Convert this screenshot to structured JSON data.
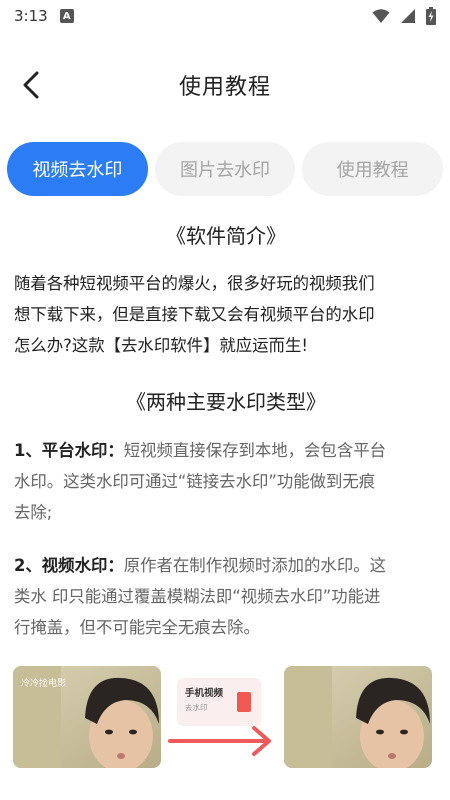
{
  "status_bar": {
    "time": "3:13",
    "notification_badge": "A"
  },
  "header": {
    "title": "使用教程"
  },
  "tabs": [
    {
      "label": "视频去水印",
      "active": true
    },
    {
      "label": "图片去水印",
      "active": false
    },
    {
      "label": "使用教程",
      "active": false
    }
  ],
  "intro": {
    "title": "《软件简介》",
    "lines": [
      "随着各种短视频平台的爆火，很多好玩的视频我们",
      "想下载下来，但是直接下载又会有视频平台的水印",
      "怎么办?这款【去水印软件】就应运而生!"
    ]
  },
  "types": {
    "title": "《两种主要水印类型》",
    "items": [
      {
        "label": "1、平台水印：",
        "lines": [
          "短视频直接保存到本地，会包含平台",
          "水印。这类水印可通过“链接去水印”功能做到无痕",
          "去除;"
        ]
      },
      {
        "label": "2、视频水印：",
        "lines": [
          "原作者在制作视频时添加的水印。这",
          "类水 印只能通过覆盖模糊法即“视频去水印”功能进",
          "行掩盖，但不可能完全无痕去除。"
        ]
      }
    ]
  },
  "illustration": {
    "watermark_text": "冷冷捡电影",
    "card_title": "手机视频",
    "card_subtitle": "去水印"
  },
  "colors": {
    "accent": "#2b7cf5",
    "arrow": "#f05a5a"
  }
}
